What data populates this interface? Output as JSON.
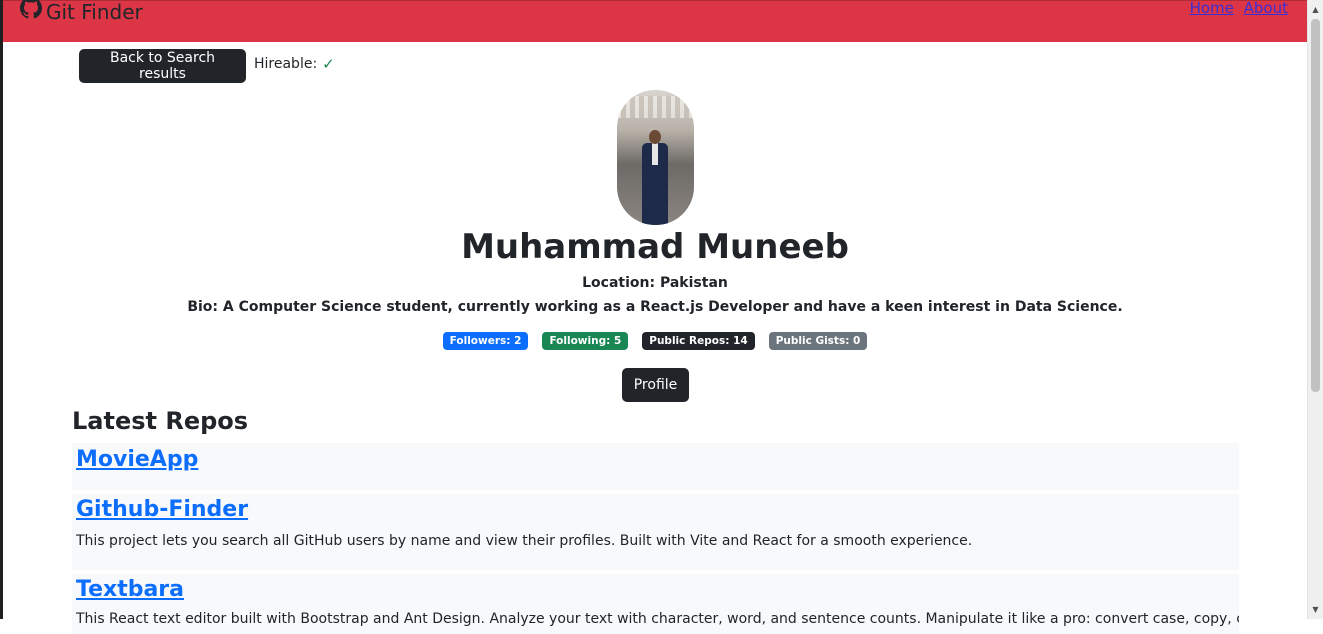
{
  "navbar": {
    "brand": "Git Finder",
    "brand_icon": "github-icon",
    "links": [
      "Home",
      "About"
    ],
    "color": "#dc3545"
  },
  "actions": {
    "back_label": "Back to Search results",
    "hireable_label": "Hireable:",
    "hireable_icon": "check-icon"
  },
  "user": {
    "name": "Muhammad Muneeb",
    "location": "Location: Pakistan",
    "bio": "Bio: A Computer Science student, currently working as a React.js Developer and have a keen interest in Data Science."
  },
  "badges": {
    "followers": "Followers: 2",
    "following": "Following: 5",
    "public_repos": "Public Repos: 14",
    "public_gists": "Public Gists: 0"
  },
  "profile_label": "Profile",
  "repos": {
    "heading": "Latest Repos",
    "items": [
      {
        "name": "MovieApp",
        "description": ""
      },
      {
        "name": "Github-Finder",
        "description": "This project lets you search all GitHub users by name and view their profiles. Built with Vite and React for a smooth experience."
      },
      {
        "name": "Textbara",
        "description": "This React text editor built with Bootstrap and Ant Design. Analyze your text with character, word, and sentence counts. Manipulate it like a pro: convert case, copy, clear, remove"
      }
    ]
  }
}
